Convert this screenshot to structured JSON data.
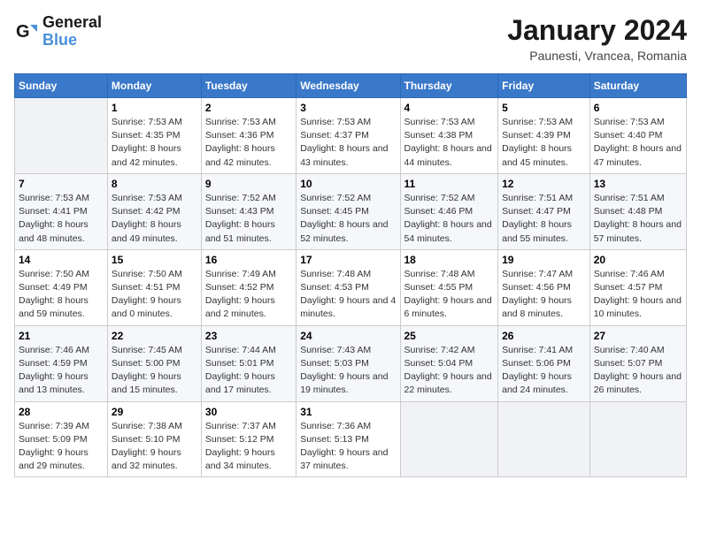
{
  "logo": {
    "text_general": "General",
    "text_blue": "Blue"
  },
  "header": {
    "month": "January 2024",
    "location": "Paunesti, Vrancea, Romania"
  },
  "days_of_week": [
    "Sunday",
    "Monday",
    "Tuesday",
    "Wednesday",
    "Thursday",
    "Friday",
    "Saturday"
  ],
  "weeks": [
    [
      {
        "day": "",
        "sunrise": "",
        "sunset": "",
        "daylight": ""
      },
      {
        "day": "1",
        "sunrise": "Sunrise: 7:53 AM",
        "sunset": "Sunset: 4:35 PM",
        "daylight": "Daylight: 8 hours and 42 minutes."
      },
      {
        "day": "2",
        "sunrise": "Sunrise: 7:53 AM",
        "sunset": "Sunset: 4:36 PM",
        "daylight": "Daylight: 8 hours and 42 minutes."
      },
      {
        "day": "3",
        "sunrise": "Sunrise: 7:53 AM",
        "sunset": "Sunset: 4:37 PM",
        "daylight": "Daylight: 8 hours and 43 minutes."
      },
      {
        "day": "4",
        "sunrise": "Sunrise: 7:53 AM",
        "sunset": "Sunset: 4:38 PM",
        "daylight": "Daylight: 8 hours and 44 minutes."
      },
      {
        "day": "5",
        "sunrise": "Sunrise: 7:53 AM",
        "sunset": "Sunset: 4:39 PM",
        "daylight": "Daylight: 8 hours and 45 minutes."
      },
      {
        "day": "6",
        "sunrise": "Sunrise: 7:53 AM",
        "sunset": "Sunset: 4:40 PM",
        "daylight": "Daylight: 8 hours and 47 minutes."
      }
    ],
    [
      {
        "day": "7",
        "sunrise": "Sunrise: 7:53 AM",
        "sunset": "Sunset: 4:41 PM",
        "daylight": "Daylight: 8 hours and 48 minutes."
      },
      {
        "day": "8",
        "sunrise": "Sunrise: 7:53 AM",
        "sunset": "Sunset: 4:42 PM",
        "daylight": "Daylight: 8 hours and 49 minutes."
      },
      {
        "day": "9",
        "sunrise": "Sunrise: 7:52 AM",
        "sunset": "Sunset: 4:43 PM",
        "daylight": "Daylight: 8 hours and 51 minutes."
      },
      {
        "day": "10",
        "sunrise": "Sunrise: 7:52 AM",
        "sunset": "Sunset: 4:45 PM",
        "daylight": "Daylight: 8 hours and 52 minutes."
      },
      {
        "day": "11",
        "sunrise": "Sunrise: 7:52 AM",
        "sunset": "Sunset: 4:46 PM",
        "daylight": "Daylight: 8 hours and 54 minutes."
      },
      {
        "day": "12",
        "sunrise": "Sunrise: 7:51 AM",
        "sunset": "Sunset: 4:47 PM",
        "daylight": "Daylight: 8 hours and 55 minutes."
      },
      {
        "day": "13",
        "sunrise": "Sunrise: 7:51 AM",
        "sunset": "Sunset: 4:48 PM",
        "daylight": "Daylight: 8 hours and 57 minutes."
      }
    ],
    [
      {
        "day": "14",
        "sunrise": "Sunrise: 7:50 AM",
        "sunset": "Sunset: 4:49 PM",
        "daylight": "Daylight: 8 hours and 59 minutes."
      },
      {
        "day": "15",
        "sunrise": "Sunrise: 7:50 AM",
        "sunset": "Sunset: 4:51 PM",
        "daylight": "Daylight: 9 hours and 0 minutes."
      },
      {
        "day": "16",
        "sunrise": "Sunrise: 7:49 AM",
        "sunset": "Sunset: 4:52 PM",
        "daylight": "Daylight: 9 hours and 2 minutes."
      },
      {
        "day": "17",
        "sunrise": "Sunrise: 7:48 AM",
        "sunset": "Sunset: 4:53 PM",
        "daylight": "Daylight: 9 hours and 4 minutes."
      },
      {
        "day": "18",
        "sunrise": "Sunrise: 7:48 AM",
        "sunset": "Sunset: 4:55 PM",
        "daylight": "Daylight: 9 hours and 6 minutes."
      },
      {
        "day": "19",
        "sunrise": "Sunrise: 7:47 AM",
        "sunset": "Sunset: 4:56 PM",
        "daylight": "Daylight: 9 hours and 8 minutes."
      },
      {
        "day": "20",
        "sunrise": "Sunrise: 7:46 AM",
        "sunset": "Sunset: 4:57 PM",
        "daylight": "Daylight: 9 hours and 10 minutes."
      }
    ],
    [
      {
        "day": "21",
        "sunrise": "Sunrise: 7:46 AM",
        "sunset": "Sunset: 4:59 PM",
        "daylight": "Daylight: 9 hours and 13 minutes."
      },
      {
        "day": "22",
        "sunrise": "Sunrise: 7:45 AM",
        "sunset": "Sunset: 5:00 PM",
        "daylight": "Daylight: 9 hours and 15 minutes."
      },
      {
        "day": "23",
        "sunrise": "Sunrise: 7:44 AM",
        "sunset": "Sunset: 5:01 PM",
        "daylight": "Daylight: 9 hours and 17 minutes."
      },
      {
        "day": "24",
        "sunrise": "Sunrise: 7:43 AM",
        "sunset": "Sunset: 5:03 PM",
        "daylight": "Daylight: 9 hours and 19 minutes."
      },
      {
        "day": "25",
        "sunrise": "Sunrise: 7:42 AM",
        "sunset": "Sunset: 5:04 PM",
        "daylight": "Daylight: 9 hours and 22 minutes."
      },
      {
        "day": "26",
        "sunrise": "Sunrise: 7:41 AM",
        "sunset": "Sunset: 5:06 PM",
        "daylight": "Daylight: 9 hours and 24 minutes."
      },
      {
        "day": "27",
        "sunrise": "Sunrise: 7:40 AM",
        "sunset": "Sunset: 5:07 PM",
        "daylight": "Daylight: 9 hours and 26 minutes."
      }
    ],
    [
      {
        "day": "28",
        "sunrise": "Sunrise: 7:39 AM",
        "sunset": "Sunset: 5:09 PM",
        "daylight": "Daylight: 9 hours and 29 minutes."
      },
      {
        "day": "29",
        "sunrise": "Sunrise: 7:38 AM",
        "sunset": "Sunset: 5:10 PM",
        "daylight": "Daylight: 9 hours and 32 minutes."
      },
      {
        "day": "30",
        "sunrise": "Sunrise: 7:37 AM",
        "sunset": "Sunset: 5:12 PM",
        "daylight": "Daylight: 9 hours and 34 minutes."
      },
      {
        "day": "31",
        "sunrise": "Sunrise: 7:36 AM",
        "sunset": "Sunset: 5:13 PM",
        "daylight": "Daylight: 9 hours and 37 minutes."
      },
      {
        "day": "",
        "sunrise": "",
        "sunset": "",
        "daylight": ""
      },
      {
        "day": "",
        "sunrise": "",
        "sunset": "",
        "daylight": ""
      },
      {
        "day": "",
        "sunrise": "",
        "sunset": "",
        "daylight": ""
      }
    ]
  ]
}
